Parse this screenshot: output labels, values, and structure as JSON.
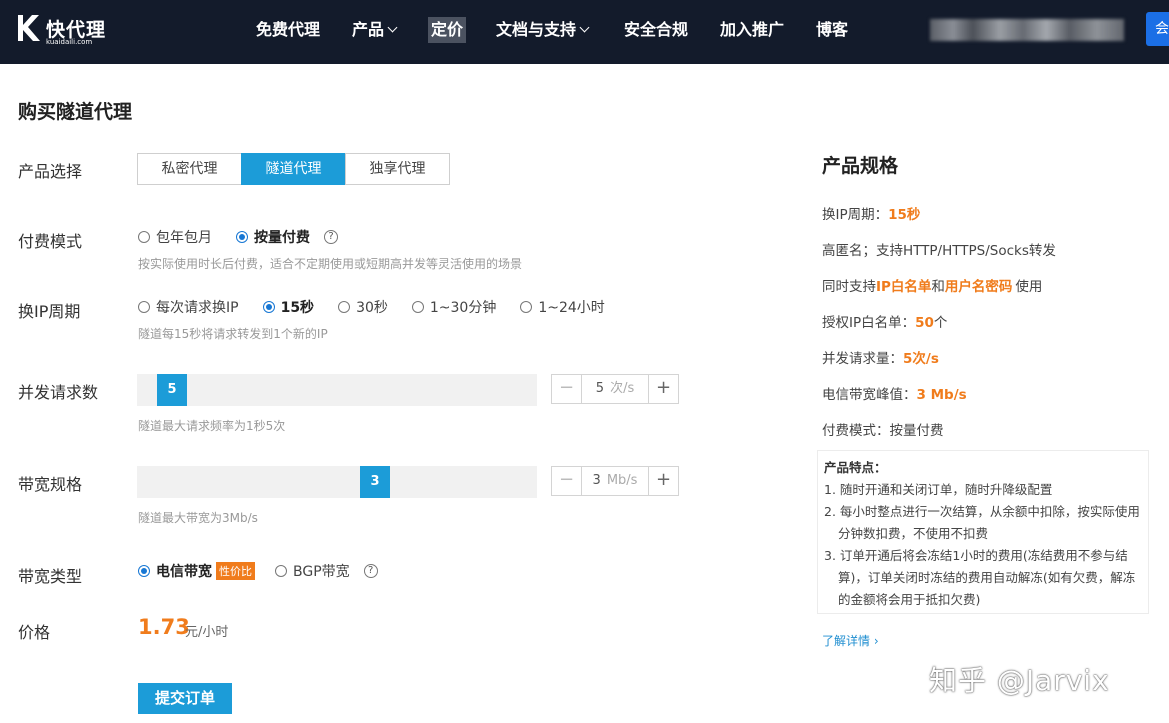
{
  "brand": {
    "name": "快代理",
    "domain": "kuaidaili.com"
  },
  "nav": {
    "items": [
      {
        "label": "免费代理"
      },
      {
        "label": "产品"
      },
      {
        "label": "定价"
      },
      {
        "label": "文档与支持"
      },
      {
        "label": "安全合规"
      },
      {
        "label": "加入推广"
      },
      {
        "label": "博客"
      }
    ],
    "member_button": "会"
  },
  "page": {
    "title": "购买隧道代理"
  },
  "form": {
    "product": {
      "label": "产品选择",
      "options": [
        "私密代理",
        "隧道代理",
        "独享代理"
      ],
      "selected": "隧道代理"
    },
    "billing": {
      "label": "付费模式",
      "options": [
        "包年包月",
        "按量付费"
      ],
      "selected": "按量付费",
      "hint": "按实际使用时长后付费，适合不定期使用或短期高并发等灵活使用的场景"
    },
    "ip_cycle": {
      "label": "换IP周期",
      "options": [
        "每次请求换IP",
        "15秒",
        "30秒",
        "1~30分钟",
        "1~24小时"
      ],
      "selected": "15秒",
      "hint": "隧道每15秒将请求转发到1个新的IP"
    },
    "concurrency": {
      "label": "并发请求数",
      "value": "5",
      "unit": "次/s",
      "hint": "隧道最大请求频率为1秒5次"
    },
    "bandwidth": {
      "label": "带宽规格",
      "value": "3",
      "unit": "Mb/s",
      "hint": "隧道最大带宽为3Mb/s"
    },
    "bandwidth_type": {
      "label": "带宽类型",
      "options": [
        "电信带宽",
        "BGP带宽"
      ],
      "selected": "电信带宽",
      "badge": "性价比"
    },
    "price": {
      "label": "价格",
      "value": "1.73",
      "unit": "元/小时"
    },
    "submit_label": "提交订单"
  },
  "spec": {
    "title": "产品规格",
    "cycle": {
      "label": "换IP周期：",
      "value": "15秒"
    },
    "anonymity": "高匿名；支持HTTP/HTTPS/Socks转发",
    "auth": {
      "prefix": "同时支持",
      "ip_whitelist": "IP白名单",
      "and": "和",
      "user_pass": "用户名密码",
      "suffix": "使用"
    },
    "whitelist": {
      "label": "授权IP白名单：",
      "value": "50",
      "suffix": "个"
    },
    "concurrency": {
      "label": "并发请求量：",
      "value": "5次/s"
    },
    "bandwidth": {
      "label": "电信带宽峰值：",
      "value": "3 Mb/s"
    },
    "billing": "付费模式：按量付费",
    "features": {
      "title": "产品特点：",
      "items": [
        "1. 随时开通和关闭订单，随时升降级配置",
        "2. 每小时整点进行一次结算，从余额中扣除，按实际使用分钟数扣费，不使用不扣费",
        "3. 订单开通后将会冻结1小时的费用(冻结费用不参与结算)，订单关闭时冻结的费用自动解冻(如有欠费，解冻的金额将会用于抵扣欠费)"
      ]
    },
    "more_link": "了解详情 ›"
  },
  "watermark": "知乎 @Jarvix",
  "colors": {
    "accent": "#1c9cd8",
    "highlight": "#f07c1c",
    "nav_bg": "#131b2b"
  }
}
